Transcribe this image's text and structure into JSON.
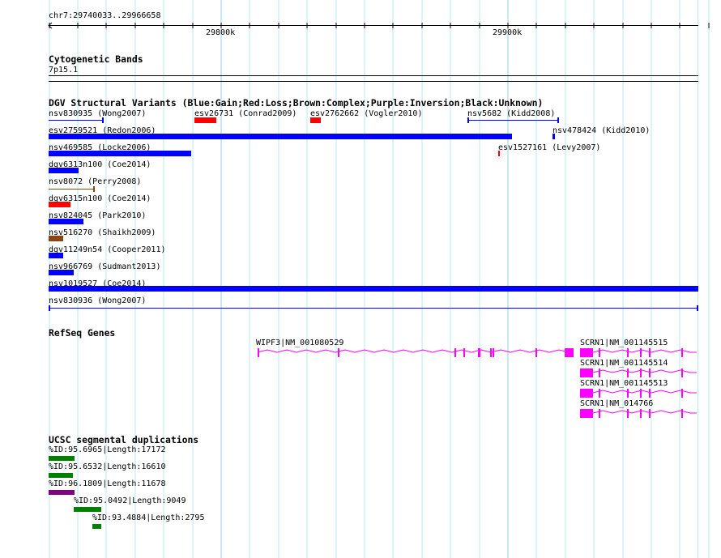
{
  "ruler": {
    "location": "chr7:29740033..29966658",
    "ticks": [
      "29800k",
      "29900k"
    ]
  },
  "cytoband": {
    "title": "Cytogenetic Bands",
    "band": "7p15.1"
  },
  "dgv": {
    "title": "DGV Structural Variants (Blue:Gain;Red:Loss;Brown:Complex;Purple:Inversion;Black:Unknown)",
    "colors": {
      "gain": "#0000ff",
      "loss": "#ff0000",
      "complex": "#8b4513"
    },
    "features": [
      {
        "label": "nsv830935 (Wong2007)",
        "type": "gain"
      },
      {
        "label": "esv26731 (Conrad2009)",
        "type": "loss"
      },
      {
        "label": "esv2762662 (Vogler2010)",
        "type": "loss"
      },
      {
        "label": "nsv5682 (Kidd2008)",
        "type": "gain"
      },
      {
        "label": "esv2759521 (Redon2006)",
        "type": "gain"
      },
      {
        "label": "nsv478424 (Kidd2010)",
        "type": "gain"
      },
      {
        "label": "nsv469585 (Locke2006)",
        "type": "gain"
      },
      {
        "label": "esv1527161 (Levy2007)",
        "type": "loss"
      },
      {
        "label": "dgv6313n100 (Coe2014)",
        "type": "gain"
      },
      {
        "label": "nsv8072 (Perry2008)",
        "type": "complex"
      },
      {
        "label": "dgv6315n100 (Coe2014)",
        "type": "loss"
      },
      {
        "label": "nsv824045 (Park2010)",
        "type": "gain"
      },
      {
        "label": "nsv516270 (Shaikh2009)",
        "type": "complex"
      },
      {
        "label": "dgv11249n54 (Cooper2011)",
        "type": "gain"
      },
      {
        "label": "nsv966769 (Sudmant2013)",
        "type": "gain"
      },
      {
        "label": "nsv1019527 (Coe2014)",
        "type": "gain"
      },
      {
        "label": "nsv830936 (Wong2007)",
        "type": "gain"
      }
    ]
  },
  "refseq": {
    "title": "RefSeq Genes",
    "color": "#ff00ff",
    "genes": [
      {
        "label": "WIPF3|NM_001080529"
      },
      {
        "label": "SCRN1|NM_001145515"
      },
      {
        "label": "SCRN1|NM_001145514"
      },
      {
        "label": "SCRN1|NM_001145513"
      },
      {
        "label": "SCRN1|NM_014766"
      }
    ]
  },
  "segdups": {
    "title": "UCSC segmental duplications",
    "colors": {
      "green": "#008000",
      "purple": "#800080"
    },
    "features": [
      {
        "label": "%ID:95.6965|Length:17172",
        "color": "green"
      },
      {
        "label": "%ID:95.6532|Length:16610",
        "color": "green"
      },
      {
        "label": "%ID:96.1809|Length:11678",
        "color": "purple"
      },
      {
        "label": "%ID:95.0492|Length:9049",
        "color": "green"
      },
      {
        "label": "%ID:93.4884|Length:2795",
        "color": "green"
      }
    ]
  }
}
